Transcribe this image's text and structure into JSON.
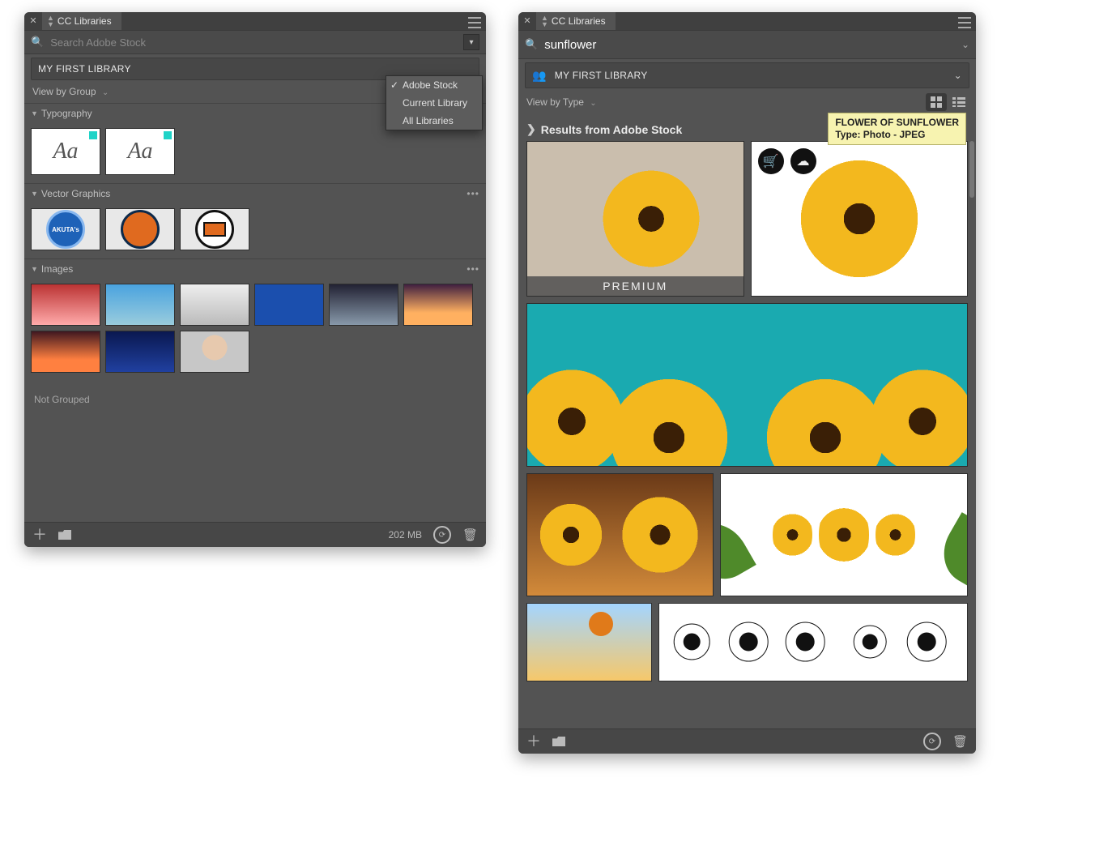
{
  "left": {
    "tab_title": "CC Libraries",
    "search_placeholder": "Search Adobe Stock",
    "library_label": "MY FIRST LIBRARY",
    "view_label": "View by Group",
    "dropdown": {
      "items": [
        "Adobe Stock",
        "Current Library",
        "All Libraries"
      ],
      "checked_index": 0
    },
    "sections": {
      "typography": {
        "title": "Typography",
        "glyph": "Aa",
        "count": 2
      },
      "vector": {
        "title": "Vector Graphics",
        "count": 3
      },
      "images": {
        "title": "Images",
        "count": 9
      }
    },
    "not_grouped_label": "Not Grouped",
    "footer_size": "202 MB"
  },
  "right": {
    "tab_title": "CC Libraries",
    "search_value": "sunflower",
    "library_label": "MY FIRST LIBRARY",
    "view_label": "View by Type",
    "results_header": "Results from Adobe Stock",
    "tooltip": {
      "title": "FLOWER OF SUNFLOWER",
      "subtitle": "Type: Photo - JPEG"
    },
    "premium_label": "PREMIUM"
  }
}
